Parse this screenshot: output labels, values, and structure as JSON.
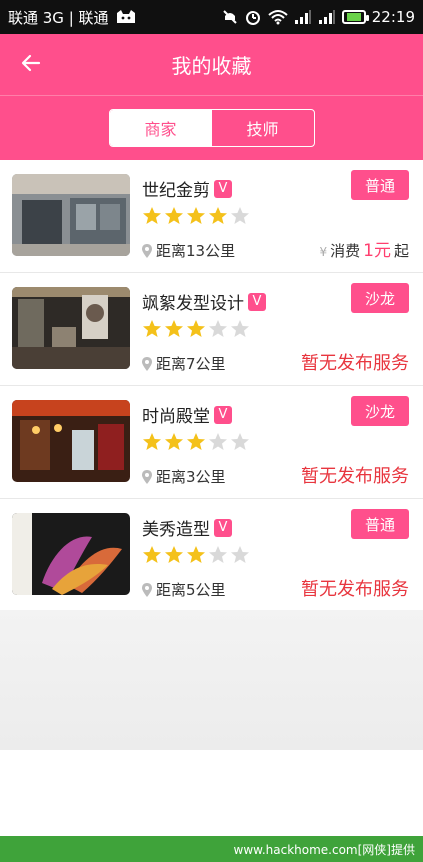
{
  "status_bar": {
    "carrier": "联通 3G | 联通",
    "time": "22:19"
  },
  "header": {
    "title": "我的收藏"
  },
  "tabs": [
    {
      "label": "商家",
      "active": true
    },
    {
      "label": "技师",
      "active": false
    }
  ],
  "colors": {
    "brand_pink": "#ff4f8c",
    "star_filled": "#f4c11a",
    "star_empty": "#d9d9d9",
    "no_service_red": "#e8363f"
  },
  "favorites": [
    {
      "name": "世纪金剪",
      "verified_badge": "V",
      "tag": "普通",
      "rating": 4,
      "distance": "距离13公里",
      "price_prefix": "消费",
      "price_value": "1元",
      "price_suffix": "起",
      "price_mark": "¥"
    },
    {
      "name": "飒絮发型设计",
      "verified_badge": "V",
      "tag": "沙龙",
      "rating": 3,
      "distance": "距离7公里",
      "status": "暂无发布服务"
    },
    {
      "name": "时尚殿堂",
      "verified_badge": "V",
      "tag": "沙龙",
      "rating": 3,
      "distance": "距离3公里",
      "status": "暂无发布服务"
    },
    {
      "name": "美秀造型",
      "verified_badge": "V",
      "tag": "普通",
      "rating": 3,
      "distance": "距离5公里",
      "status": "暂无发布服务"
    }
  ],
  "watermark": "www.hackhome.com[网侠]提供"
}
